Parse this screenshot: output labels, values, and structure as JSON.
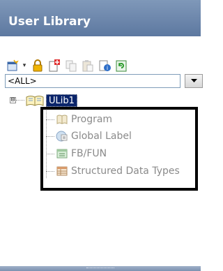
{
  "panel": {
    "title": "User Library"
  },
  "toolbar": {
    "buttons": [
      {
        "icon": "new-library-icon",
        "has_dropdown": true
      },
      {
        "icon": "lock-icon"
      },
      {
        "icon": "new-data-icon"
      },
      {
        "icon": "copy-icon"
      },
      {
        "icon": "paste-icon"
      },
      {
        "icon": "properties-icon"
      },
      {
        "icon": "refresh-icon"
      }
    ]
  },
  "filter": {
    "selected": "<ALL>"
  },
  "tree": {
    "root": {
      "label": "ULib1",
      "expander": "⊟",
      "selected": true
    },
    "children": [
      {
        "label": "Program",
        "icon": "program-icon"
      },
      {
        "label": "Global Label",
        "icon": "global-label-icon"
      },
      {
        "label": "FB/FUN",
        "icon": "fb-fun-icon"
      },
      {
        "label": "Structured Data Types",
        "icon": "structured-data-types-icon"
      }
    ]
  },
  "colors": {
    "header": "#6a84aa",
    "selection": "#0a246a",
    "disabled_text": "#8a8a8a",
    "highlight_border": "#000000"
  }
}
